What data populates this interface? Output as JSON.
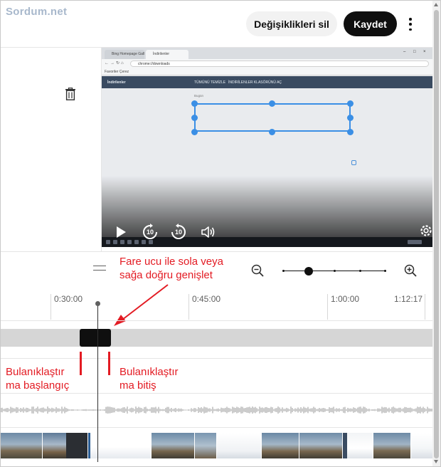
{
  "watermark": "Sordum.net",
  "header": {
    "discard_label": "Değişiklikleri sil",
    "save_label": "Kaydet",
    "more_icon": "more-vert-icon"
  },
  "editor": {
    "delete_icon": "trash-icon"
  },
  "preview": {
    "browser_tab_1": "Bing Homepage Gallery",
    "browser_tab_2": "İndirilenler",
    "address": "chrome://downloads",
    "bookmarks_bar": "Favoriler  Çerez",
    "site_title": "İndirilenler",
    "site_menu_1": "TÜMÜNÜ TEMİZLE",
    "site_menu_2": "İNDİRİLENLER KLASÖRÜNÜ AÇ",
    "card_label": "Bugün",
    "controls": {
      "play_icon": "play-icon",
      "rewind_label": "10",
      "forward_label": "10",
      "volume_icon": "volume-icon",
      "settings_icon": "gear-icon"
    }
  },
  "timeline": {
    "zoom": {
      "zoom_out_icon": "zoom-out-icon",
      "zoom_in_icon": "zoom-in-icon",
      "level": 0.25
    },
    "ticks": [
      "0:30:00",
      "0:45:00",
      "1:00:00",
      "1:12:17"
    ]
  },
  "annotations": {
    "hint_line_1": "Fare ucu ile sola veya",
    "hint_line_2": "sağa doğru genişlet",
    "start_line_1": "Bulanıklaştır",
    "start_line_2": "ma başlangıç",
    "end_line_1": "Bulanıklaştır",
    "end_line_2": "ma bitiş"
  },
  "colors": {
    "annotation": "#e31b23",
    "primary_button": "#0f0f0f",
    "secondary_button": "#f2f2f2",
    "blur_track": "#d6d6d6",
    "blur_segment": "#0f0f0f",
    "selection": "#3b8fe5"
  }
}
